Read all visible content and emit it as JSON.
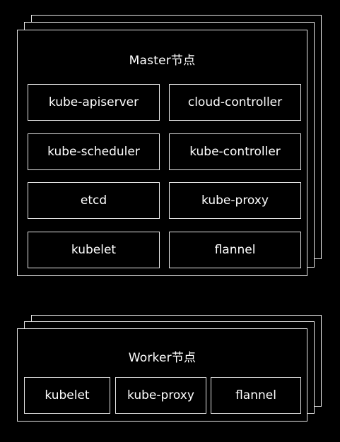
{
  "master": {
    "title": "Master节点",
    "components": [
      "kube-apiserver",
      "cloud-controller",
      "kube-scheduler",
      "kube-controller",
      "etcd",
      "kube-proxy",
      "kubelet",
      "flannel"
    ]
  },
  "worker": {
    "title": "Worker节点",
    "components": [
      "kubelet",
      "kube-proxy",
      "flannel"
    ]
  },
  "colors": {
    "background": "#000000",
    "stroke": "#e6e6e6",
    "text": "#ffffff"
  }
}
